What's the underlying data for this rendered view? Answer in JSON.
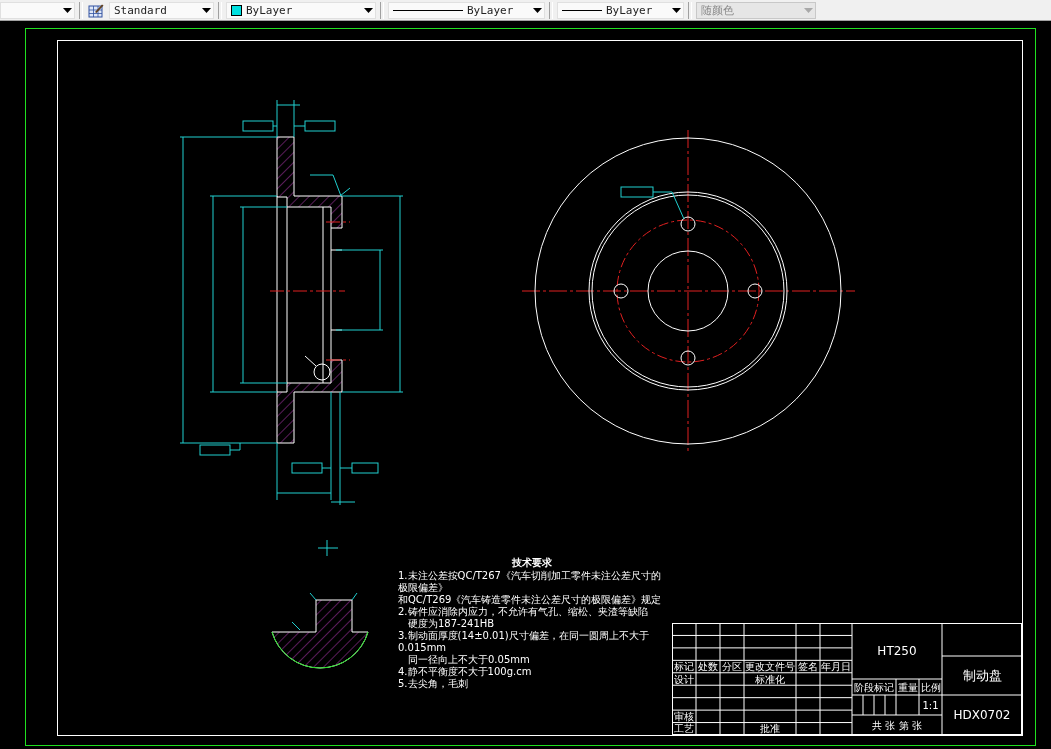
{
  "toolbar": {
    "dropdowns": [
      {
        "kind": "blank",
        "disabled": false
      },
      {
        "kind": "textstyle",
        "value": "Standard",
        "disabled": false
      },
      {
        "kind": "color",
        "value": "ByLayer",
        "disabled": false
      },
      {
        "kind": "linetype",
        "value": "ByLayer",
        "disabled": false
      },
      {
        "kind": "lineweight",
        "value": "ByLayer",
        "disabled": false
      },
      {
        "kind": "plotstyle",
        "value": "随颜色",
        "disabled": true
      }
    ]
  },
  "notes": {
    "title": "技术要求",
    "lines": [
      {
        "text": "1.未注公差按QC/T267《汽车切削加工零件未注公差尺寸的极限偏差》",
        "indent": false
      },
      {
        "text": "和QC/T269《汽车铸造零件未注公差尺寸的极限偏差》规定",
        "indent": false
      },
      {
        "text": "2.铸件应消除内应力，不允许有气孔、缩松、夹渣等缺陷",
        "indent": false
      },
      {
        "text": "硬度为187-241HB",
        "indent": true
      },
      {
        "text": "3.制动面厚度(14±0.01)尺寸偏差，在同一圆周上不大于0.015mm",
        "indent": false
      },
      {
        "text": "同一径向上不大于0.05mm",
        "indent": true
      },
      {
        "text": "4.静不平衡度不大于100g.cm",
        "indent": false
      },
      {
        "text": "5.去尖角，毛刺",
        "indent": false
      }
    ]
  },
  "title_block": {
    "header_labels": [
      "标记",
      "处数",
      "分区",
      "更改文件号",
      "签名",
      "年月日"
    ],
    "design_label": "设计",
    "standardization_label": "标准化",
    "review_label": "审核",
    "process_label": "工艺",
    "approval_label": "批准",
    "material": "HT250",
    "stage_labels": [
      "阶段标记",
      "重量",
      "比例"
    ],
    "scale": "1:1",
    "sheet_label": "共 张 第 张",
    "part_name": "制动盘",
    "drawing_number": "HDX0702"
  }
}
